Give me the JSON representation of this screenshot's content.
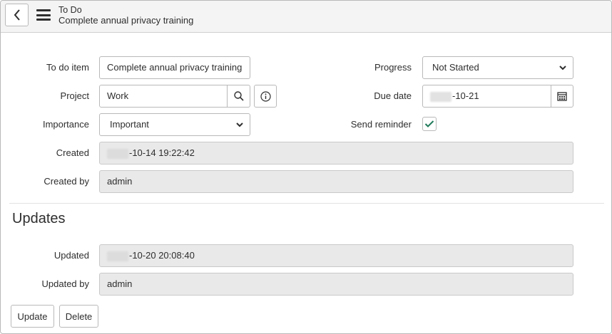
{
  "header": {
    "title": "To Do",
    "subtitle": "Complete annual privacy training"
  },
  "form": {
    "todo_item": {
      "label": "To do item",
      "value": "Complete annual privacy training"
    },
    "project": {
      "label": "Project",
      "value": "Work"
    },
    "importance": {
      "label": "Importance",
      "value": "Important"
    },
    "created": {
      "label": "Created",
      "value": "-10-14 19:22:42"
    },
    "created_by": {
      "label": "Created by",
      "value": "admin"
    },
    "progress": {
      "label": "Progress",
      "value": "Not Started"
    },
    "due_date": {
      "label": "Due date",
      "value": "-10-21"
    },
    "send_reminder": {
      "label": "Send reminder",
      "checked": true
    }
  },
  "updates": {
    "title": "Updates",
    "updated": {
      "label": "Updated",
      "value": "-10-20 20:08:40"
    },
    "updated_by": {
      "label": "Updated by",
      "value": "admin"
    }
  },
  "actions": {
    "update_label": "Update",
    "delete_label": "Delete"
  },
  "colors": {
    "check": "#1f7a5a",
    "readonly_bg": "#e9e9e9",
    "header_bg": "#f4f4f4"
  }
}
